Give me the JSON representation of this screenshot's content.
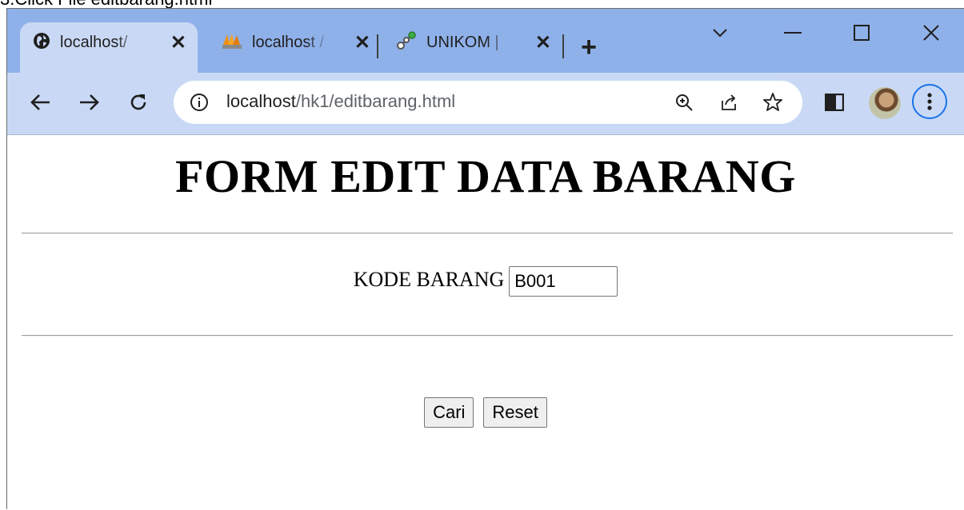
{
  "caption": "3.Click File editbarang.html",
  "browser": {
    "tabs": [
      {
        "title": "localhost/",
        "icon": "globe-icon",
        "active": true
      },
      {
        "title": "localhost /",
        "icon": "phpmyadmin-icon",
        "active": false
      },
      {
        "title": "UNIKOM |",
        "icon": "network-icon",
        "active": false
      }
    ],
    "new_tab_label": "+",
    "url_host": "localhost",
    "url_path": "/hk1/editbarang.html",
    "accent_color": "#1a73e8",
    "tabstrip_color": "#8fb1ea",
    "toolbar_color": "#c9d9f5"
  },
  "page": {
    "title": "FORM EDIT DATA BARANG",
    "kode_label": "KODE BARANG",
    "kode_value": "B001",
    "search_button": "Cari",
    "reset_button": "Reset"
  }
}
